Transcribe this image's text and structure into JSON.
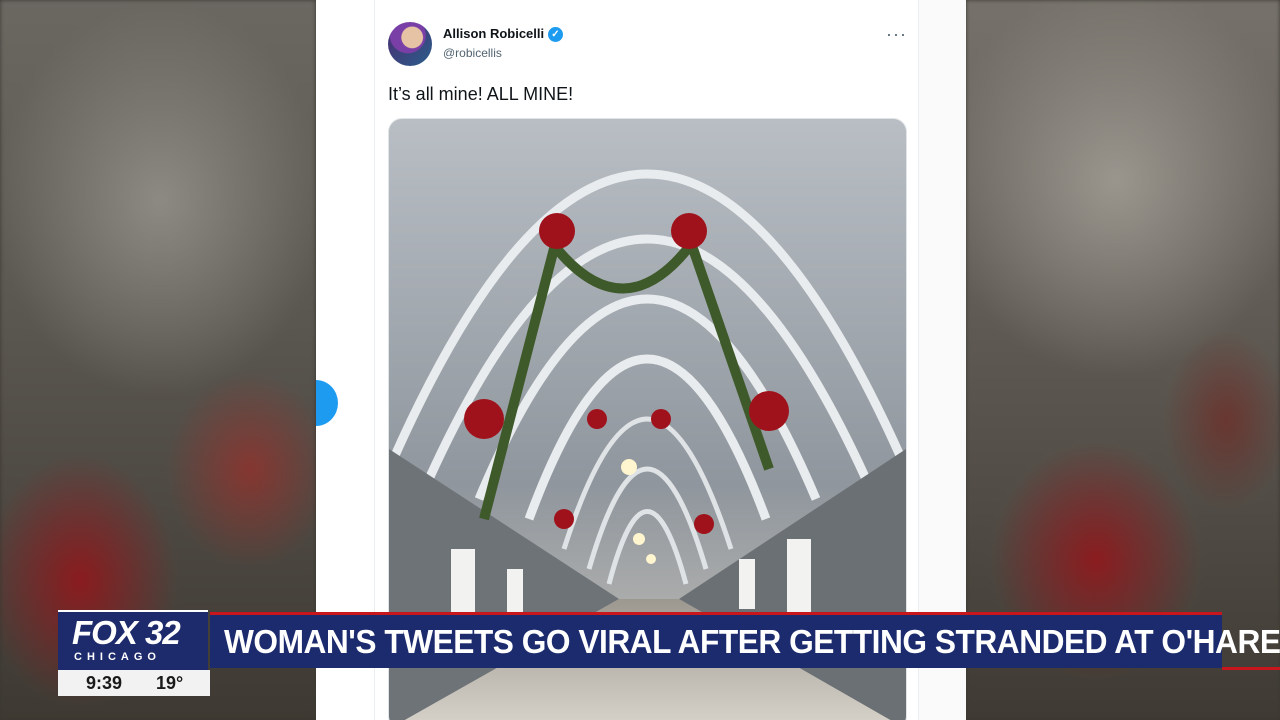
{
  "tweet": {
    "author_name": "Allison Robicelli",
    "handle": "@robicellis",
    "text": "It’s all mine! ALL MINE!",
    "verified_glyph": "✓",
    "more_glyph": "···"
  },
  "chyron": {
    "logo_brand": "FOX 32",
    "logo_city": "CHICAGO",
    "headline": "WOMAN'S TWEETS GO VIRAL AFTER GETTING STRANDED AT O'HARE",
    "time": "9:39",
    "temperature": "19°"
  },
  "colors": {
    "chyron_blue": "#1c2b6e",
    "chyron_red": "#c7161c",
    "twitter_blue": "#1d9bf0"
  }
}
